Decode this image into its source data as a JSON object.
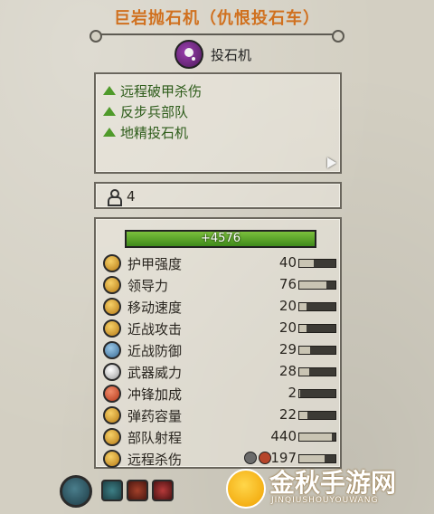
{
  "title": "巨岩抛石机（仇恨投石车）",
  "unit": {
    "name": "投石机",
    "icon": "catapult-unit-icon"
  },
  "abilities": [
    "远程破甲杀伤",
    "反步兵部队",
    "地精投石机"
  ],
  "soldiers": {
    "count": "4",
    "icon": "soldier-icon"
  },
  "health": {
    "value": "4576",
    "prefix": "+"
  },
  "stats": [
    {
      "label": "护甲强度",
      "value": "40",
      "fill": 0.4,
      "icon": "armor-icon",
      "tone": "gold"
    },
    {
      "label": "领导力",
      "value": "76",
      "fill": 0.76,
      "icon": "leadership-icon",
      "tone": "gold"
    },
    {
      "label": "移动速度",
      "value": "20",
      "fill": 0.2,
      "icon": "speed-icon",
      "tone": "gold"
    },
    {
      "label": "近战攻击",
      "value": "20",
      "fill": 0.2,
      "icon": "melee-attack-icon",
      "tone": "gold"
    },
    {
      "label": "近战防御",
      "value": "29",
      "fill": 0.29,
      "icon": "melee-defense-icon",
      "tone": "blue"
    },
    {
      "label": "武器威力",
      "value": "28",
      "fill": 0.28,
      "icon": "weapon-strength-icon",
      "tone": "white"
    },
    {
      "label": "冲锋加成",
      "value": "2",
      "fill": 0.02,
      "icon": "charge-bonus-icon",
      "tone": "red"
    },
    {
      "label": "弹药容量",
      "value": "22",
      "fill": 0.22,
      "icon": "ammunition-icon",
      "tone": "gold"
    },
    {
      "label": "部队射程",
      "value": "440",
      "fill": 0.9,
      "icon": "range-icon",
      "tone": "gold"
    },
    {
      "label": "远程杀伤",
      "value": "197",
      "fill": 0.7,
      "icon": "missile-damage-icon",
      "tone": "gold"
    }
  ],
  "bottom_icons": [
    "unit-type-icon",
    "attribute-icon-1",
    "attribute-icon-2",
    "attribute-icon-3"
  ],
  "watermark": {
    "main": "金秋手游网",
    "sub": "JINQIUSHOUYOUWANG"
  },
  "colors": {
    "title": "#d0701e",
    "ability_text": "#2d5c1a",
    "ability_marker": "#4f9a2a",
    "health": "#5aa22a"
  }
}
